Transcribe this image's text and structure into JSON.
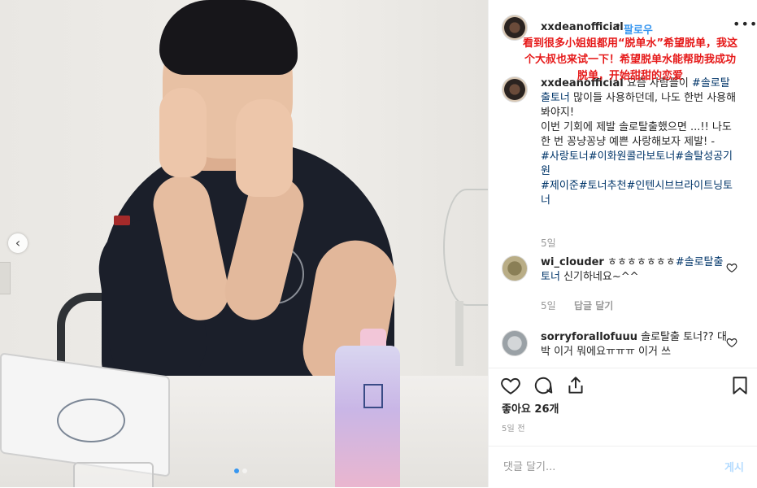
{
  "post": {
    "username": "xxdeanofficial",
    "separator": "•",
    "follow_label": "팔로우",
    "more_label": "•••",
    "overlay_text": "看到很多小姐姐都用“脱单水”希望脱单，我这个大叔也来试一下！希望脱单水能帮助我成功脱单，开始甜甜的恋爱",
    "caption": {
      "username": "xxdeanofficial",
      "text_1": " 요즘 사람들이 ",
      "tag_1": "#솔로탈출토너",
      "text_2": " 많이들 사용하던데, 나도 한번 사용해봐야지!",
      "text_3": "이번 기회에 제발 솔로탈출했으면 ...!! 나도 한 번 꽁냥꽁냥 예쁜 사랑해보자 제발! -",
      "tags_1": "#사랑토너#이화원콜라보토너#솔탈성공기원",
      "tags_2": "#제이준#토너추천#인텐시브브라이트닝토너",
      "time": "5일"
    },
    "comments": [
      {
        "username": "wi_clouder",
        "text": " ㅎㅎㅎㅎㅎㅎㅎ",
        "tag": "#솔로탈출토너",
        "text_after": " 신기하네요~^^",
        "time": "5일",
        "reply_label": "답글 달기"
      },
      {
        "username": "sorryforallofuuu",
        "text": " 솔로탈출 토너?? 대박 이거 뭐에요ㅠㅠㅠ 이거 쓰"
      }
    ],
    "likes": "좋아요 26개",
    "ago": "5일 전",
    "add_comment_placeholder": "댓글 달기...",
    "post_label": "게시",
    "photo": {
      "dots": 2,
      "active_dot": 1
    },
    "colors": {
      "link": "#3897f0",
      "hashtag": "#003569",
      "overlay": "#e61a1a",
      "post_button": "#b3dbff"
    }
  }
}
